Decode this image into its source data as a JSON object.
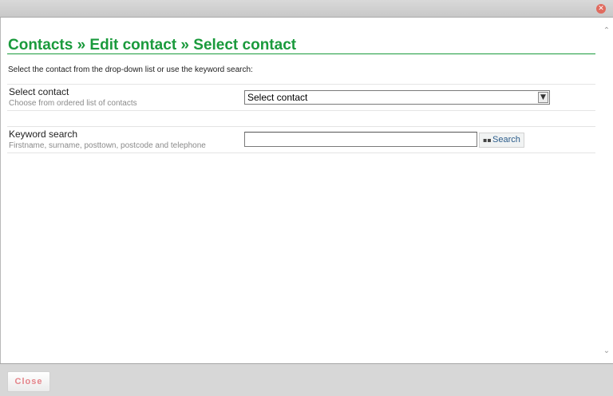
{
  "window": {
    "close_icon": "close-x-icon"
  },
  "page": {
    "title": "Contacts » Edit contact » Select contact",
    "intro": "Select the contact from the drop-down list or use the keyword search:"
  },
  "select_contact": {
    "label": "Select contact",
    "hint": "Choose from ordered list of contacts",
    "selected": "Select contact"
  },
  "keyword_search": {
    "label": "Keyword search",
    "hint": "Firstname, surname, posttown, postcode and telephone",
    "value": "",
    "button_label": "Search",
    "button_icon": "binoculars-icon"
  },
  "footer": {
    "close_label": "Close"
  },
  "colors": {
    "title_green": "#1a9a3c",
    "close_text": "#e4848a",
    "search_text": "#2a5b8a"
  }
}
